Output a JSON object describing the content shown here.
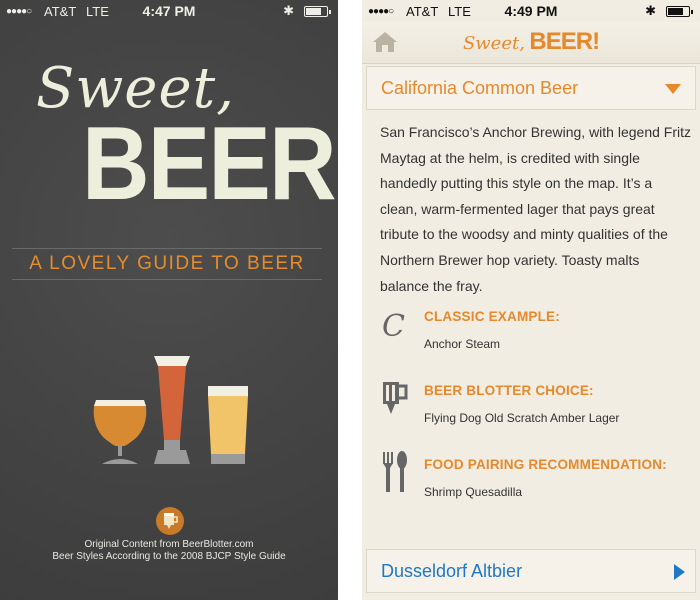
{
  "splash": {
    "status": {
      "dots": "●●●●○",
      "carrier": "AT&T",
      "network": "LTE",
      "time": "4:47 PM",
      "bluetooth": "✱"
    },
    "logo_sweet": "Sweet,",
    "logo_beer": "BEER!",
    "tagline": "A LOVELY GUIDE TO BEER",
    "footer_line1": "Original Content from BeerBlotter.com",
    "footer_line2": "Beer Styles According to the 2008 BJCP Style Guide"
  },
  "detail": {
    "status": {
      "dots": "●●●●○",
      "carrier": "AT&T",
      "network": "LTE",
      "time": "4:49 PM",
      "bluetooth": "✱"
    },
    "header_logo_sweet": "Sweet,",
    "header_logo_beer": "BEER!",
    "style_title": "California Common Beer",
    "description": "San Francisco’s Anchor Brewing, with legend Fritz Maytag at the helm, is credited with single handedly putting this style on the map. It’s a clean, warm-fermented lager that pays great tribute to the woodsy and minty qualities of the Northern Brewer hop variety. Toasty malts balance the fray.",
    "classic_label": "CLASSIC EXAMPLE:",
    "classic_value": "Anchor Steam",
    "blotter_label": "BEER BLOTTER CHOICE:",
    "blotter_value": "Flying Dog Old Scratch Amber Lager",
    "food_label": "FOOD PAIRING RECOMMENDATION:",
    "food_value": "Shrimp Quesadilla",
    "next_style": "Dusseldorf Altbier"
  },
  "colors": {
    "accent": "#e5892c",
    "link": "#1d78c6",
    "splash_bg": "#454545",
    "detail_bg": "#f1ede2"
  },
  "icons": [
    "battery-icon",
    "bluetooth-icon",
    "tulip-glass-icon",
    "pint-glass-icon",
    "tall-glass-icon",
    "beerblotter-icon",
    "home-icon",
    "chevron-down-icon",
    "script-c-icon",
    "beer-mug-icon",
    "fork-spoon-icon",
    "chevron-right-icon"
  ]
}
